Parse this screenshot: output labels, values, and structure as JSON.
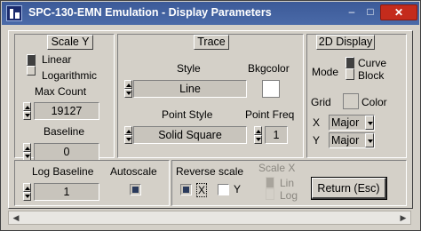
{
  "window": {
    "title": "SPC-130-EMN Emulation - Display Parameters",
    "min_symbol": "–",
    "max_symbol": "□",
    "close_symbol": "✕"
  },
  "scale_y": {
    "title": "Scale Y",
    "linear_label": "Linear",
    "log_label": "Logarithmic",
    "max_count_label": "Max Count",
    "max_count_value": "19127",
    "baseline_label": "Baseline",
    "baseline_value": "0",
    "log_baseline_label": "Log Baseline",
    "log_baseline_value": "1"
  },
  "trace": {
    "title": "Trace",
    "style_label": "Style",
    "style_value": "Line",
    "bkgcolor_label": "Bkgcolor",
    "point_style_label": "Point Style",
    "point_style_value": "Solid Square",
    "point_freq_label": "Point Freq",
    "point_freq_value": "1"
  },
  "display2d": {
    "title": "2D Display",
    "mode_label": "Mode",
    "curve_label": "Curve",
    "block_label": "Block",
    "grid_label": "Grid",
    "color_label": "Color",
    "x_label": "X",
    "x_value": "Major",
    "y_label": "Y",
    "y_value": "Major"
  },
  "autoscale": {
    "label": "Autoscale",
    "checked": true
  },
  "reverse_scale": {
    "label": "Reverse scale",
    "x_label": "X",
    "x_checked": true,
    "y_label": "Y",
    "y_checked": false
  },
  "scale_x": {
    "title": "Scale X",
    "lin_label": "Lin",
    "log_label": "Log"
  },
  "return_button": {
    "label": "Return (Esc)"
  },
  "scrollbar": {
    "left_arrow": "◀",
    "right_arrow": "▶"
  }
}
